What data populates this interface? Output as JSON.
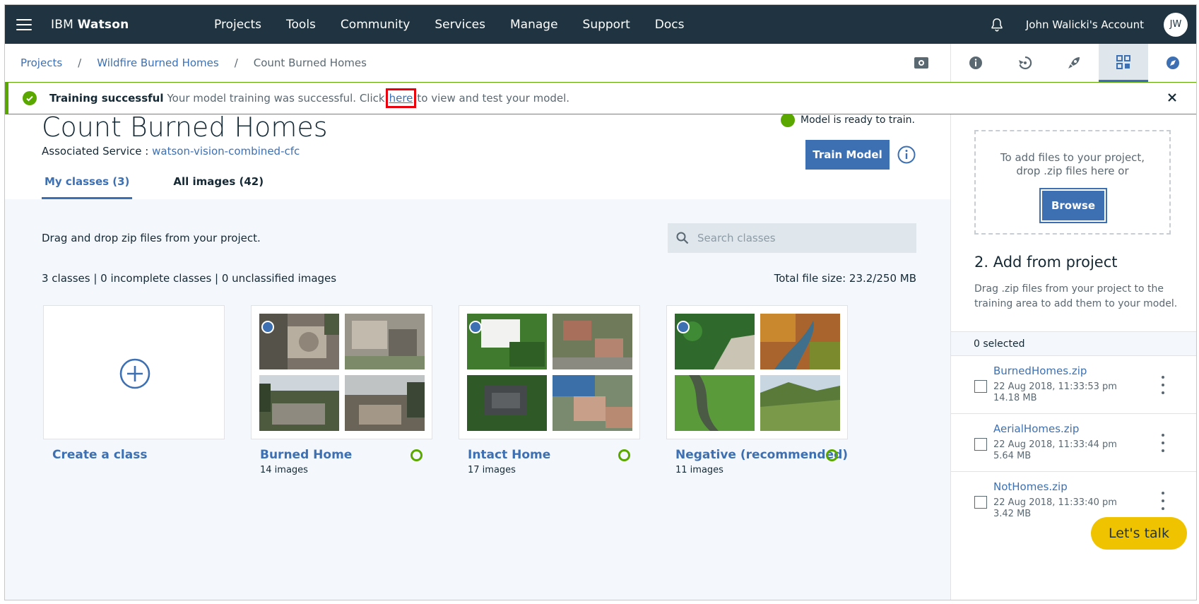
{
  "topnav": {
    "brand_light": "IBM ",
    "brand_bold": "Watson",
    "items": [
      "Projects",
      "Tools",
      "Community",
      "Services",
      "Manage",
      "Support",
      "Docs"
    ],
    "account": "John Walicki's Account",
    "avatar_initials": "JW"
  },
  "breadcrumb": {
    "items": [
      "Projects",
      "Wildfire Burned Homes"
    ],
    "current": "Count Burned Homes",
    "separator": "/"
  },
  "notification": {
    "title": "Training successful",
    "message_before": "Your model training was successful. Click",
    "link": "here",
    "message_after": "to view and test your model."
  },
  "header": {
    "title": "Count Burned Homes",
    "assoc_label": "Associated Service : ",
    "assoc_value": "watson-vision-combined-cfc",
    "ready_text": "Model is ready to train.",
    "train_button": "Train Model"
  },
  "tabs": [
    "My classes (3)",
    "All images (42)"
  ],
  "content": {
    "drag_text": "Drag and drop zip files from your project.",
    "search_placeholder": "Search classes",
    "stats": "3 classes | 0 incomplete classes | 0 unclassified images",
    "file_size": "Total file size: 23.2/250 MB",
    "create_label": "Create a class",
    "classes": [
      {
        "name": "Burned Home",
        "count": "14 images"
      },
      {
        "name": "Intact Home",
        "count": "17 images"
      },
      {
        "name": "Negative (recommended)",
        "count": "11 images"
      }
    ]
  },
  "rightpanel": {
    "drop_text": "To add files to your project,\ndrop .zip files here or",
    "browse": "Browse",
    "add_title": "2. Add from project",
    "add_desc": "Drag .zip files from your project to the training area to add them to your model.",
    "selected": "0 selected",
    "files": [
      {
        "name": "BurnedHomes.zip",
        "date": "22 Aug 2018, 11:33:53 pm",
        "size": "14.18 MB"
      },
      {
        "name": "AerialHomes.zip",
        "date": "22 Aug 2018, 11:33:44 pm",
        "size": "5.64 MB"
      },
      {
        "name": "NotHomes.zip",
        "date": "22 Aug 2018, 11:33:40 pm",
        "size": "3.42 MB"
      }
    ]
  },
  "chat": {
    "label": "Let's talk"
  },
  "colors": {
    "accent": "#3d70b2",
    "nav": "#1f3440",
    "success": "#5aa700",
    "chat": "#f0c300"
  }
}
